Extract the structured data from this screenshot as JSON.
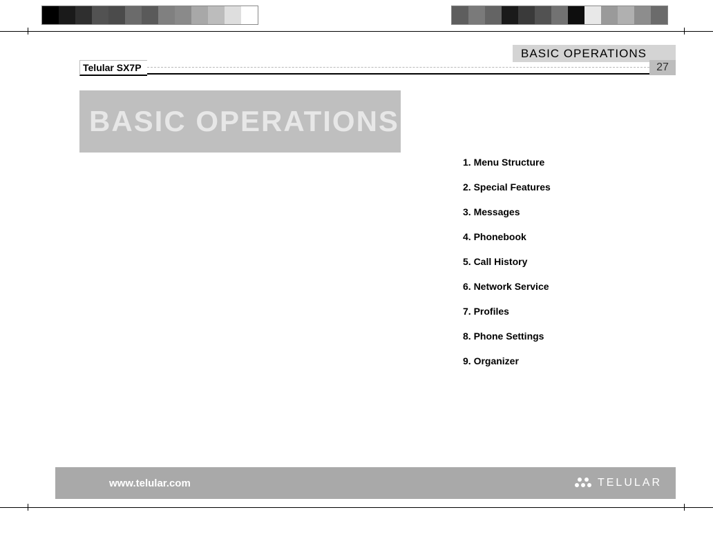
{
  "header": {
    "section_label": "BASIC OPERATIONS",
    "product": "Telular SX7P",
    "page_number": "27"
  },
  "title": "BASIC OPERATIONS",
  "toc": [
    "1. Menu Structure",
    "2. Special Features",
    "3. Messages",
    "4. Phonebook",
    "5. Call History",
    "6. Network Service",
    "7. Profiles",
    "8. Phone Settings",
    "9. Organizer"
  ],
  "footer": {
    "url": "www.telular.com",
    "brand": "TELULAR"
  },
  "swatches_left": [
    "#000000",
    "#1a1a1a",
    "#2f2f2f",
    "#525252",
    "#4b4b4b",
    "#6b6b6b",
    "#5a5a5a",
    "#808080",
    "#8a8a8a",
    "#a8a8a8",
    "#bcbcbc",
    "#dedede",
    "#ffffff"
  ],
  "swatches_right": [
    "#5e5e5e",
    "#7a7a7a",
    "#646464",
    "#1a1a1a",
    "#3a3a3a",
    "#525252",
    "#727272",
    "#0e0e0e",
    "#e8e8e8",
    "#9a9a9a",
    "#b0b0b0",
    "#8d8d8d",
    "#6b6b6b"
  ]
}
